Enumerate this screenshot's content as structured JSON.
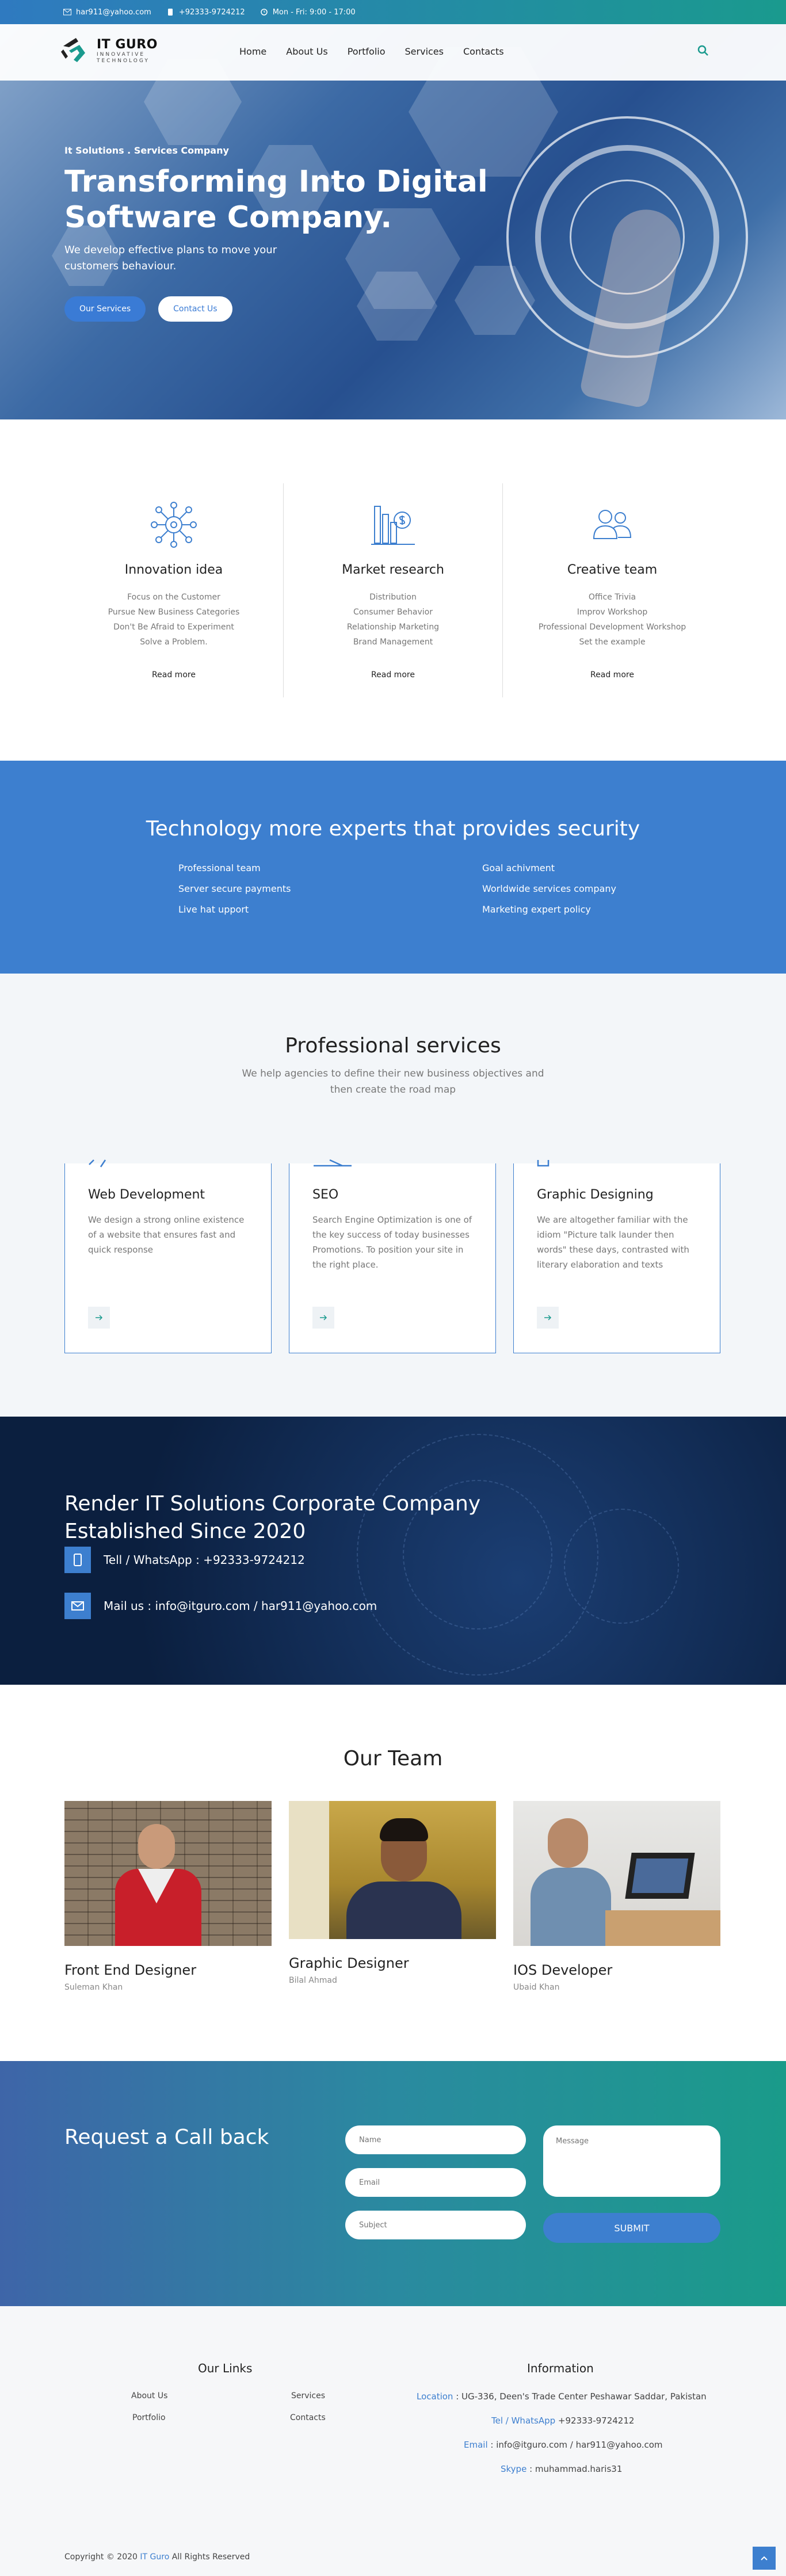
{
  "topbar": {
    "email": "har911@yahoo.com",
    "phone": "+92333-9724212",
    "hours": "Mon - Fri: 9:00 - 17:00"
  },
  "header": {
    "brand": "IT GURO",
    "brand_sub1": "INNOVATIVE",
    "brand_sub2": "TECHNOLOGY",
    "nav": [
      "Home",
      "About Us",
      "Portfolio",
      "Services",
      "Contacts"
    ]
  },
  "hero": {
    "subtitle": "It Solutions . Services Company",
    "title": "Transforming Into Digital Software Company.",
    "description": "We develop effective plans to move your customers behaviour.",
    "btn_primary": "Our Services",
    "btn_secondary": "Contact Us"
  },
  "features": [
    {
      "title": "Innovation idea",
      "items": [
        "Focus on the Customer",
        "Pursue New Business Categories",
        "Don't Be Afraid to Experiment",
        "Solve a Problem."
      ],
      "more": "Read more"
    },
    {
      "title": "Market research",
      "items": [
        "Distribution",
        "Consumer Behavior",
        "Relationship Marketing",
        "Brand Management"
      ],
      "more": "Read more"
    },
    {
      "title": "Creative team",
      "items": [
        "Office Trivia",
        "Improv Workshop",
        "Professional Development Workshop",
        "Set the example"
      ],
      "more": "Read more"
    }
  ],
  "tech": {
    "title": "Technology more experts that provides security",
    "left": [
      "Professional team",
      "Server secure payments",
      "Live hat upport"
    ],
    "right": [
      "Goal achivment",
      "Worldwide services company",
      "Marketing expert policy"
    ]
  },
  "services": {
    "title": "Professional services",
    "description": "We help agencies to define their new business objectives and then create the road map",
    "cards": [
      {
        "title": "Web Development",
        "description": "We design a strong online existence of a website that ensures fast and quick response"
      },
      {
        "title": "SEO",
        "description": "Search Engine Optimization is one of the key success of today businesses Promotions. To position your site in the right place."
      },
      {
        "title": "Graphic Designing",
        "description": "We are altogether familiar with the idiom \"Picture talk launder then words\" these days, contrasted with literary elaboration and texts"
      }
    ]
  },
  "render": {
    "title": "Render IT Solutions Corporate Company Established Since 2020",
    "phone": "Tell / WhatsApp : +92333-9724212",
    "mail": "Mail us : info@itguro.com / har911@yahoo.com"
  },
  "team": {
    "title": "Our Team",
    "members": [
      {
        "role": "Front End Designer",
        "name": "Suleman Khan"
      },
      {
        "role": "Graphic Designer",
        "name": "Bilal Ahmad"
      },
      {
        "role": "IOS Developer",
        "name": "Ubaid Khan"
      }
    ]
  },
  "callback": {
    "title": "Request a Call back",
    "name_ph": "Name",
    "email_ph": "Email",
    "subject_ph": "Subject",
    "message_ph": "Message",
    "submit": "SUBMIT"
  },
  "footer": {
    "links_title": "Our Links",
    "links": [
      "About Us",
      "Services",
      "Portfolio",
      "Contacts"
    ],
    "info_title": "Information",
    "location_label": "Location",
    "location": " : UG-336, Deen's Trade Center Peshawar Saddar, Pakistan",
    "tel_label": "Tel / WhatsApp",
    "tel": " +92333-9724212",
    "email_label": "Email",
    "email": " : info@itguro.com / har911@yahoo.com",
    "skype_label": "Skype",
    "skype": " : muhammad.haris31",
    "copyright_pre": "Copyright © 2020",
    "copyright_brand": "IT Guro",
    "copyright_post": "All Rights Reserved"
  },
  "colors": {
    "accent": "#3d7fcf",
    "teal": "#1a9a8e",
    "dark": "#0b1f3f"
  }
}
